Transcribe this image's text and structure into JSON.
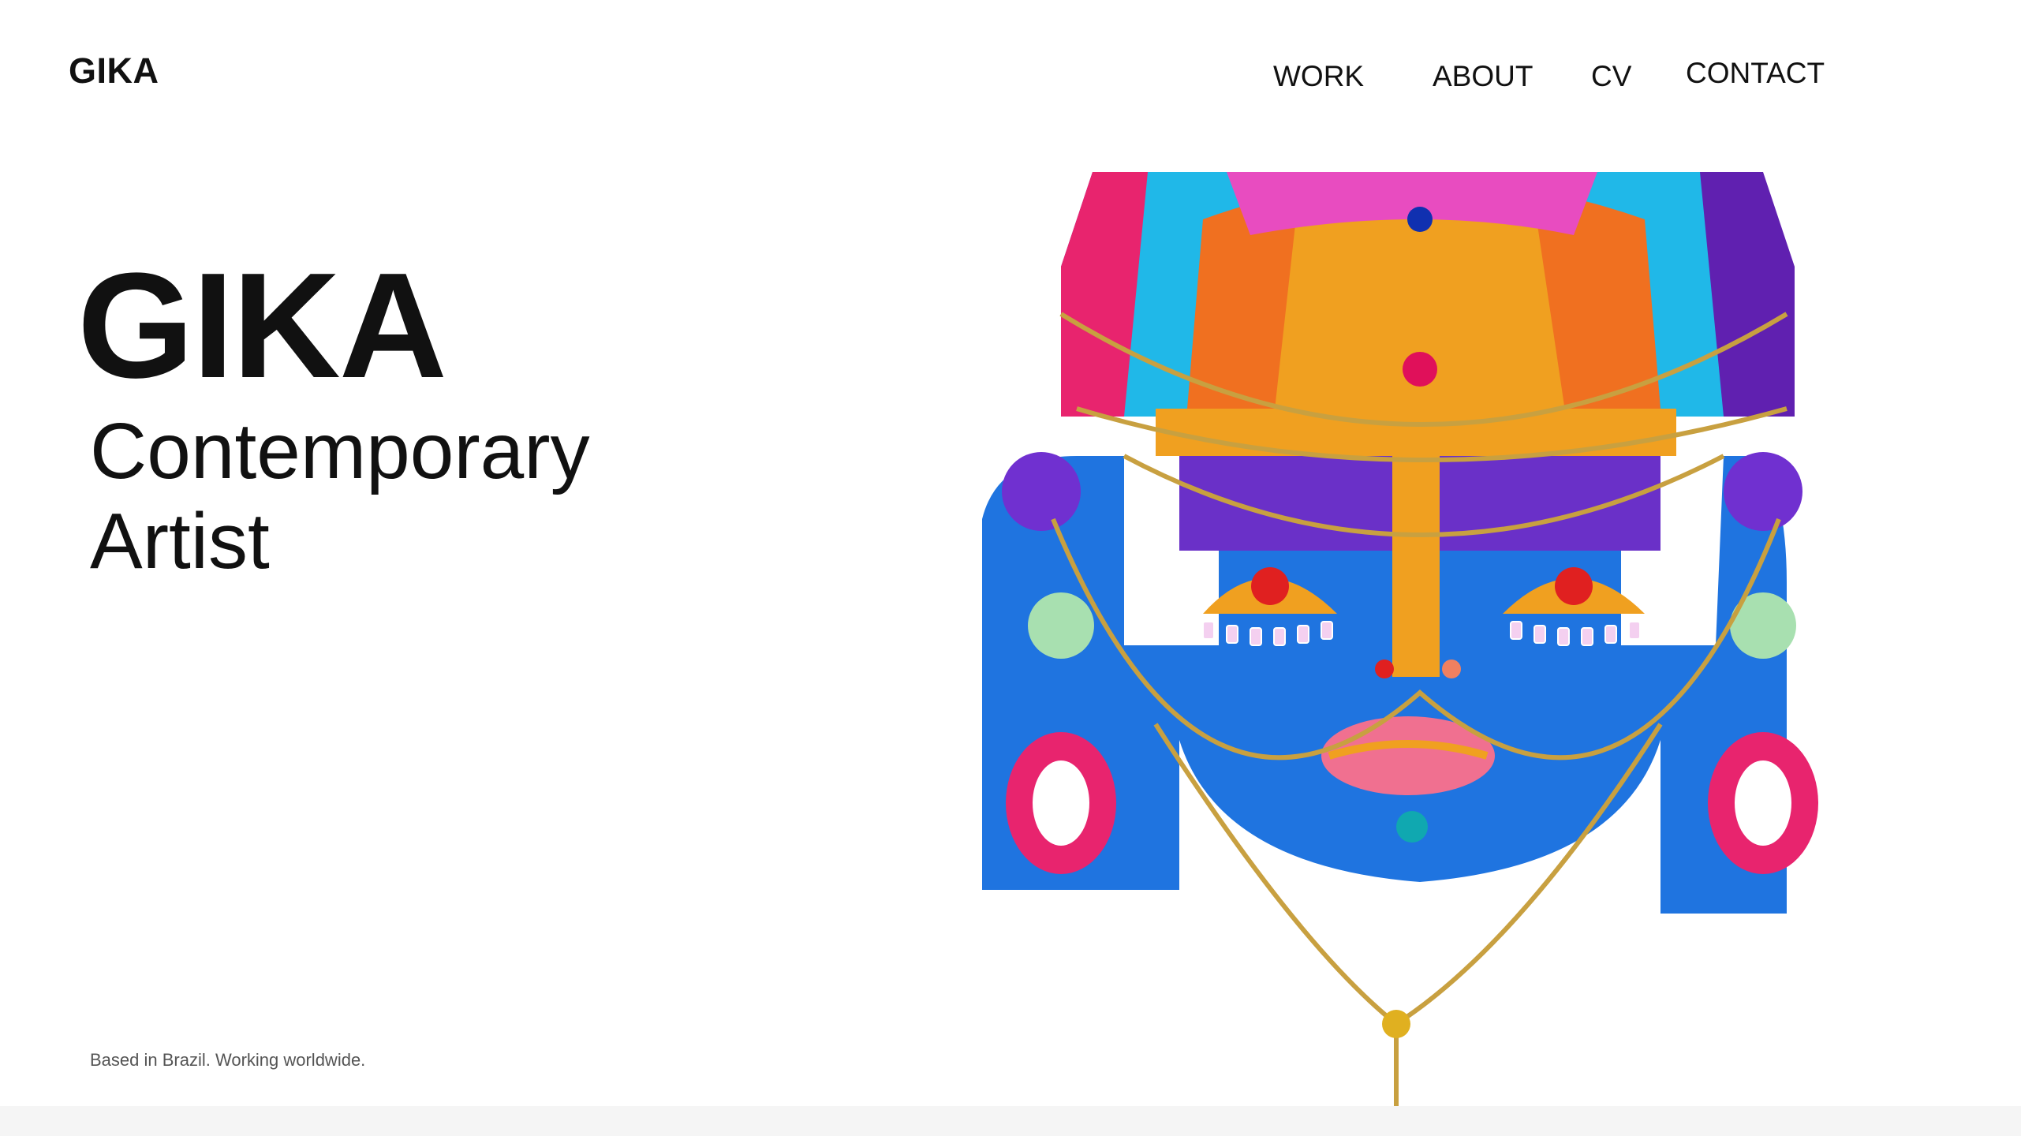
{
  "header": {
    "logo": "GIKA",
    "nav": [
      {
        "label": "WORK"
      },
      {
        "label": "ABOUT"
      },
      {
        "label": "CV"
      },
      {
        "label": "CONTACT"
      }
    ]
  },
  "hero": {
    "title": "GIKA",
    "subtitle_line1": "Contemporary",
    "subtitle_line2": "Artist"
  },
  "footer": {
    "note": "Based in Brazil. Working worldwide."
  },
  "artwork": {
    "icon": "mask-artwork-image",
    "colors": {
      "face_blue": "#1f74e0",
      "headdress_orange": "#f0a020",
      "pink": "#e8246e",
      "purple": "#6020b0",
      "cyan": "#20b8e8",
      "gold_chain": "#c8a040"
    }
  }
}
